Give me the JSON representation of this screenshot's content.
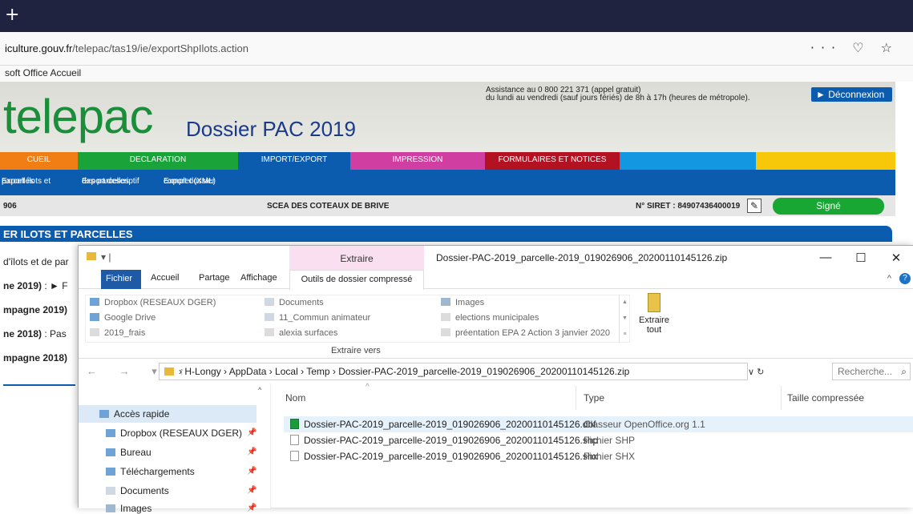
{
  "browser": {
    "new_tab": "+",
    "url_host": "iculture.gouv.fr",
    "url_path": "/telepac/tas19/ie/exportShpIlots.action",
    "toolbar_icons": "··· ♡ ☆",
    "bookmark": "soft Office Accueil"
  },
  "telepac": {
    "logo": "telepac",
    "dossier_title": "Dossier PAC 2019",
    "assist_line1": "Assistance au 0 800 221 371 (appel gratuit)",
    "assist_line2": "du lundi au vendredi (sauf jours fériés) de 8h à 17h (heures de métropole).",
    "logout": "► Déconnexion",
    "menu": [
      {
        "label": "CUEIL",
        "color": "#f07e15"
      },
      {
        "label": "DECLARATION",
        "color": "#1aa338"
      },
      {
        "label": "IMPORT/EXPORT",
        "color": "#0b5cae"
      },
      {
        "label": "IMPRESSION",
        "color": "#d13ea1"
      },
      {
        "label": "FORMULAIRES ET NOTICES",
        "color": "#b31222"
      },
      {
        "label": "",
        "color": "#1297e0"
      },
      {
        "label": "",
        "color": "#f7c70a"
      }
    ],
    "submenu": [
      {
        "l1": "Export îlots et",
        "l2": "parcelles"
      },
      {
        "l1": "Export descriptif",
        "l2": "des parcelles"
      },
      {
        "l1": "Export dossier",
        "l2": "complet (XML)"
      }
    ],
    "info_left": "906",
    "info_company": "SCEA DES COTEAUX DE BRIVE",
    "siret": "N° SIRET : 84907436400019",
    "signed": "Signé",
    "section_title": "ER ILOTS ET PARCELLES",
    "lines": [
      {
        "bold": "",
        "text": "d'îlots et de par"
      },
      {
        "bold": "ne 2019)",
        "text": " : ► F"
      },
      {
        "bold": "mpagne 2019)",
        "text": ""
      },
      {
        "bold": "ne 2018)",
        "text": " : Pas"
      },
      {
        "bold": "mpagne 2018)",
        "text": ""
      }
    ]
  },
  "explorer": {
    "qat": "▾ |",
    "extract_tab": "Extraire",
    "window_title": "Dossier-PAC-2019_parcelle-2019_019026906_20200110145126.zip",
    "controls": [
      "—",
      "☐",
      "✕"
    ],
    "tabs": {
      "fichier": "Fichier",
      "accueil": "Accueil",
      "partage": "Partage",
      "affichage": "Affichage",
      "outils": "Outils de dossier compressé"
    },
    "destinations": [
      {
        "label": "Dropbox (RESEAUX DGER)",
        "icon": "blue"
      },
      {
        "label": "Google Drive",
        "icon": "blue"
      },
      {
        "label": "2019_frais",
        "icon": "folder"
      },
      {
        "label": "Documents",
        "icon": "doc"
      },
      {
        "label": "11_Commun animateur",
        "icon": "doc"
      },
      {
        "label": "alexia surfaces",
        "icon": "folder"
      },
      {
        "label": "Images",
        "icon": "img"
      },
      {
        "label": "elections municipales",
        "icon": "folder"
      },
      {
        "label": "préentation EPA 2 Action 3 janvier 2020",
        "icon": "folder"
      }
    ],
    "extract_to": "Extraire vers",
    "extract_all_1": "Extraire",
    "extract_all_2": "tout",
    "nav_arrows": "← → ▾ ↑",
    "path": "› H-Longy › AppData › Local › Temp › Dossier-PAC-2019_parcelle-2019_019026906_20200110145126.zip",
    "search_placeholder": "Recherche...",
    "nav_items": [
      {
        "label": "Accès rapide",
        "icon": "blue"
      },
      {
        "label": "Dropbox (RESEAUX DGER)",
        "icon": "blue"
      },
      {
        "label": "Bureau",
        "icon": "blue"
      },
      {
        "label": "Téléchargements",
        "icon": "blue"
      },
      {
        "label": "Documents",
        "icon": "doc"
      },
      {
        "label": "Images",
        "icon": "img"
      }
    ],
    "columns": {
      "name": "Nom",
      "type": "Type",
      "size": "Taille compressée"
    },
    "files": [
      {
        "name": "Dossier-PAC-2019_parcelle-2019_019026906_20200110145126.dbf",
        "type": "Classeur OpenOffice.org 1.1",
        "icon": "calc"
      },
      {
        "name": "Dossier-PAC-2019_parcelle-2019_019026906_20200110145126.shp",
        "type": "Fichier SHP",
        "icon": "blank"
      },
      {
        "name": "Dossier-PAC-2019_parcelle-2019_019026906_20200110145126.shx",
        "type": "Fichier SHX",
        "icon": "blank"
      }
    ]
  }
}
